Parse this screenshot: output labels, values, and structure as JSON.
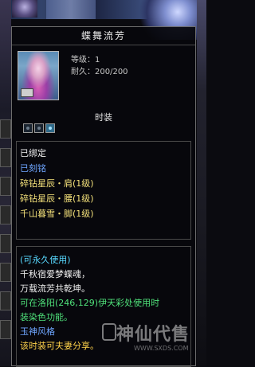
{
  "tooltip": {
    "title": "蝶舞流芳",
    "level": "等级：1",
    "durability": "耐久：200/200",
    "section": "时装",
    "sockets": [
      {
        "icon": "socket-empty",
        "filled": false
      },
      {
        "icon": "socket-empty",
        "filled": false
      },
      {
        "icon": "socket-gem",
        "filled": true
      }
    ],
    "attributes": [
      {
        "text": "已绑定",
        "color": "#f0f0f0"
      },
      {
        "text": "已刻铭",
        "color": "#6fa6ff"
      },
      {
        "text": "碎钻星辰・肩(1级)",
        "color": "#f3e07a"
      },
      {
        "text": "碎钻星辰・腰(1级)",
        "color": "#f3e07a"
      },
      {
        "text": "千山暮雪・脚(1级)",
        "color": "#f3e07a"
      }
    ],
    "description": {
      "usage": "(可永久使用)",
      "poem1": "千秋宿爱梦蝶魂，",
      "poem2": "万载流芳共乾坤。",
      "dye1": "可在洛阳(246,129)伊天彩处使用时",
      "dye2": "装染色功能。",
      "style": "玉神风格",
      "couple": "该时装可夫妻分享。"
    }
  },
  "watermark": {
    "text": "神仙代售",
    "url": "WWW.SXDS.COM"
  }
}
